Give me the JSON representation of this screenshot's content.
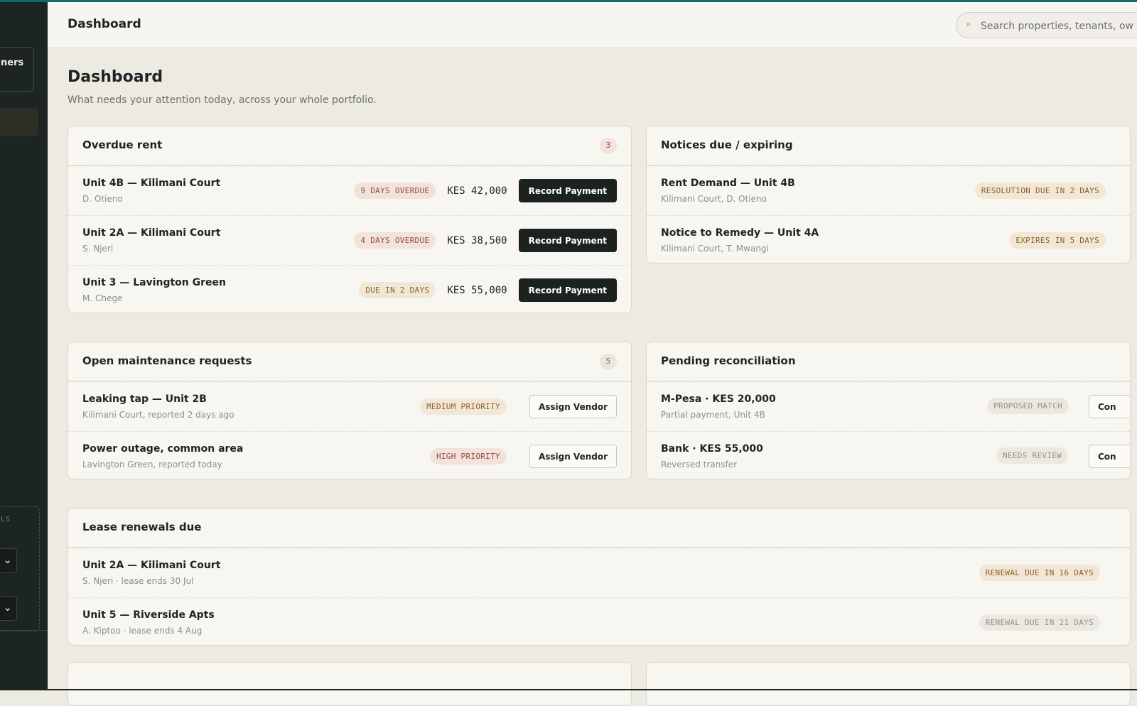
{
  "topbar": {
    "title": "Dashboard",
    "search_placeholder": "Search properties, tenants, ow"
  },
  "sidebar": {
    "owner_label": "ners",
    "filters_label": "LS",
    "select_chevron": "⌄"
  },
  "page": {
    "title": "Dashboard",
    "subtitle": "What needs your attention today, across your whole portfolio."
  },
  "overdue_rent": {
    "title": "Overdue rent",
    "count": "3",
    "items": [
      {
        "title": "Unit 4B — Kilimani Court",
        "subtitle": "D. Otieno",
        "status": "9 DAYS OVERDUE",
        "amount": "KES 42,000",
        "action": "Record Payment"
      },
      {
        "title": "Unit 2A — Kilimani Court",
        "subtitle": "S. Njeri",
        "status": "4 DAYS OVERDUE",
        "amount": "KES 38,500",
        "action": "Record Payment"
      },
      {
        "title": "Unit 3 — Lavington Green",
        "subtitle": "M. Chege",
        "status": "DUE IN 2 DAYS",
        "amount": "KES 55,000",
        "action": "Record Payment"
      }
    ]
  },
  "notices": {
    "title": "Notices due / expiring",
    "items": [
      {
        "title": "Rent Demand — Unit 4B",
        "subtitle": "Kilimani Court, D. Otieno",
        "status": "RESOLUTION DUE IN 2 DAYS"
      },
      {
        "title": "Notice to Remedy — Unit 4A",
        "subtitle": "Kilimani Court, T. Mwangi",
        "status": "EXPIRES IN 5 DAYS"
      }
    ]
  },
  "maintenance": {
    "title": "Open maintenance requests",
    "count": "5",
    "items": [
      {
        "title": "Leaking tap — Unit 2B",
        "subtitle": "Kilimani Court, reported 2 days ago",
        "status": "MEDIUM PRIORITY",
        "action": "Assign Vendor"
      },
      {
        "title": "Power outage, common area",
        "subtitle": "Lavington Green, reported today",
        "status": "HIGH PRIORITY",
        "action": "Assign Vendor"
      }
    ]
  },
  "reconciliation": {
    "title": "Pending reconciliation",
    "items": [
      {
        "title": "M-Pesa · KES 20,000",
        "subtitle": "Partial payment, Unit 4B",
        "status": "PROPOSED MATCH",
        "action": "Con"
      },
      {
        "title": "Bank · KES 55,000",
        "subtitle": "Reversed transfer",
        "status": "NEEDS REVIEW",
        "action": "Con"
      }
    ]
  },
  "renewals": {
    "title": "Lease renewals due",
    "items": [
      {
        "title": "Unit 2A — Kilimani Court",
        "subtitle": "S. Njeri · lease ends 30 Jul",
        "status": "RENEWAL DUE IN 16 DAYS"
      },
      {
        "title": "Unit 5 — Riverside Apts",
        "subtitle": "A. Kiptoo · lease ends 4 Aug",
        "status": "RENEWAL DUE IN 21 DAYS"
      }
    ]
  },
  "colors": {
    "accent": "#0f6b6b",
    "sidebar_bg": "#1d2523",
    "page_bg": "#edeae2",
    "card_bg": "#f8f6f0",
    "button_dark": "#1b2220",
    "danger_tag": "#9a4a3a",
    "warning_tag": "#8d6225",
    "neutral_tag": "#8d928f"
  },
  "icons": {
    "search": "search-icon",
    "chevron": "chevron-down-icon"
  }
}
